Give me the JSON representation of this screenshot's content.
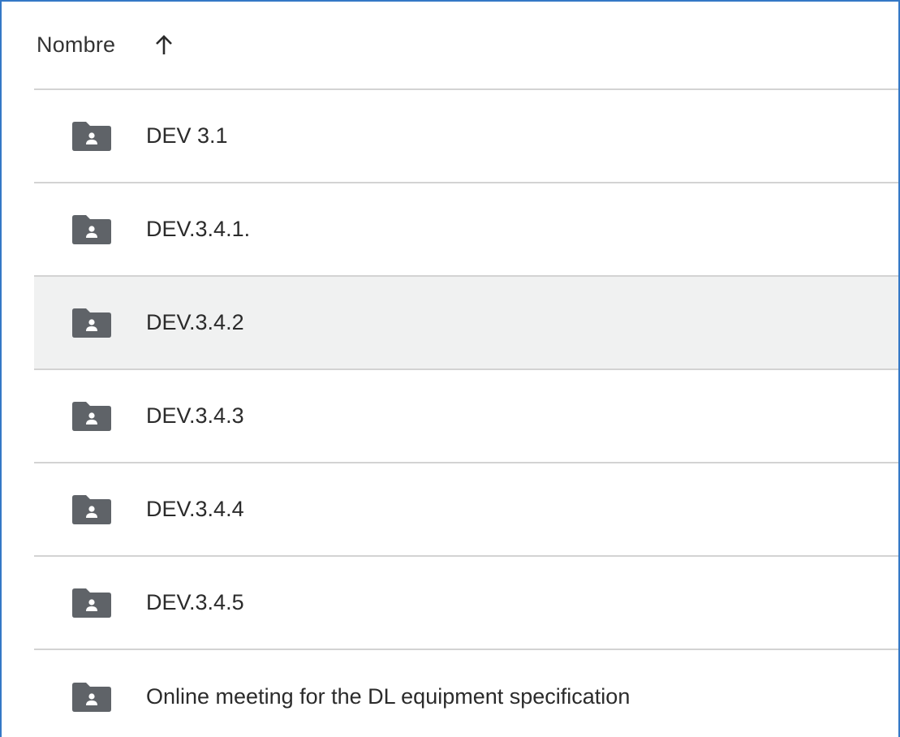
{
  "header": {
    "column_label": "Nombre",
    "sort_icon": "arrow-up-icon",
    "sort_direction": "ascending"
  },
  "items": [
    {
      "label": "DEV 3.1",
      "icon": "shared-folder-icon",
      "selected": false
    },
    {
      "label": "DEV.3.4.1.",
      "icon": "shared-folder-icon",
      "selected": false
    },
    {
      "label": "DEV.3.4.2",
      "icon": "shared-folder-icon",
      "selected": true
    },
    {
      "label": "DEV.3.4.3",
      "icon": "shared-folder-icon",
      "selected": false
    },
    {
      "label": "DEV.3.4.4",
      "icon": "shared-folder-icon",
      "selected": false
    },
    {
      "label": "DEV.3.4.5",
      "icon": "shared-folder-icon",
      "selected": false
    },
    {
      "label": "Online meeting for the DL equipment specification",
      "icon": "shared-folder-icon",
      "selected": false
    }
  ],
  "colors": {
    "frame_border": "#3478c6",
    "divider": "#d3d3d3",
    "selected_row": "#f0f1f1",
    "icon": "#5f6368",
    "text": "#2b2b2b"
  }
}
